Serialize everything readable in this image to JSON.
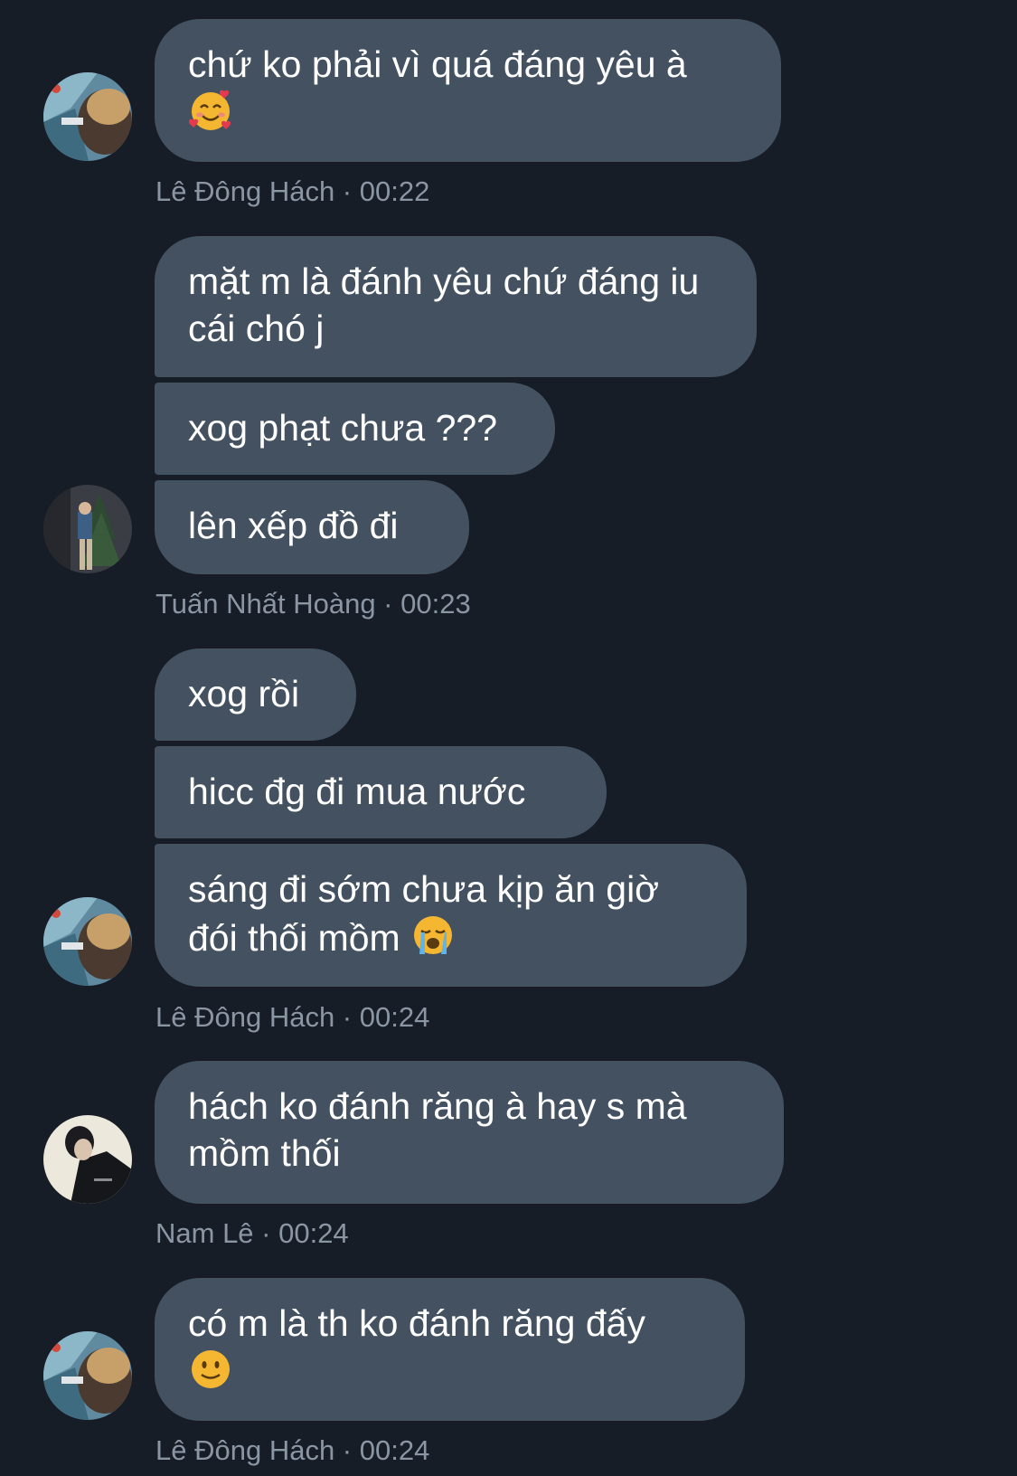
{
  "messages": [
    {
      "text": "chứ ko phải vì quá đáng yêu à",
      "emoji": "smiling-face-with-hearts",
      "emoji_char": "🥰"
    },
    {
      "text": "mặt m là đánh yêu chứ đáng iu cái chó j"
    },
    {
      "text": "xog phạt chưa ???"
    },
    {
      "text": "lên xếp đồ đi"
    },
    {
      "text": "xog rồi"
    },
    {
      "text": "hicc đg đi mua nước"
    },
    {
      "text": "sáng đi sớm chưa kịp ăn giờ đói thối mồm",
      "emoji": "loudly-crying-face",
      "emoji_char": "😭"
    },
    {
      "text": "hách ko đánh răng à hay s mà mồm thối"
    },
    {
      "text": "có m là th ko đánh răng đấy",
      "emoji": "slightly-smiling-face",
      "emoji_char": "🙂"
    }
  ],
  "meta": [
    {
      "sender": "Lê Đông Hách",
      "time": "00:22",
      "label": "Lê Đông Hách · 00:22"
    },
    {
      "sender": "Tuấn Nhất Hoàng",
      "time": "00:23",
      "label": "Tuấn Nhất Hoàng · 00:23"
    },
    {
      "sender": "Lê Đông Hách",
      "time": "00:24",
      "label": "Lê Đông Hách · 00:24"
    },
    {
      "sender": "Nam Lê",
      "time": "00:24",
      "label": "Nam Lê · 00:24"
    },
    {
      "sender": "Lê Đông Hách",
      "time": "00:24",
      "label": "Lê Đông Hách · 00:24"
    }
  ],
  "colors": {
    "background": "#171d27",
    "bubble": "#435161",
    "text": "#ffffff",
    "meta_text": "#8b96a4"
  }
}
